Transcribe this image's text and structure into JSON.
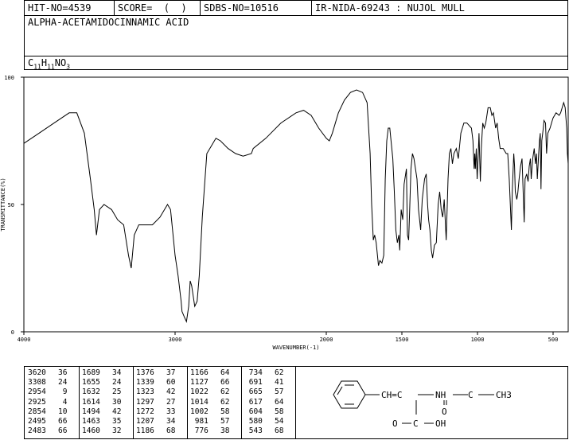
{
  "header": {
    "hit_no": "HIT-NO=4539",
    "score": "SCORE=  (  )",
    "sdbs_no": "SDBS-NO=10516",
    "ir_id": "IR-NIDA-69243 : NUJOL MULL",
    "compound_name": "ALPHA-ACETAMIDOCINNAMIC ACID",
    "formula": {
      "c": "C",
      "c_n": "11",
      "h": "H",
      "h_n": "11",
      "rest": "NO",
      "o_n": "3"
    }
  },
  "chart_data": {
    "type": "line",
    "xlabel": "WAVENUMBER(-1)",
    "ylabel": "TRANSMITTANCE(%)",
    "xlim": [
      4000,
      400
    ],
    "ylim": [
      0,
      100
    ],
    "x_ticks": [
      4000,
      3000,
      2000,
      1500,
      1000,
      500
    ],
    "y_ticks": [
      0,
      50,
      100
    ],
    "x_tick_labels": [
      "4000",
      "3000",
      "2000",
      "1500",
      "1000",
      "500"
    ],
    "y_tick_labels": [
      "0",
      "50",
      "100"
    ],
    "series": [
      {
        "points": [
          [
            4000,
            74
          ],
          [
            3900,
            78
          ],
          [
            3800,
            82
          ],
          [
            3700,
            86
          ],
          [
            3650,
            86
          ],
          [
            3600,
            78
          ],
          [
            3560,
            60
          ],
          [
            3535,
            48
          ],
          [
            3520,
            38
          ],
          [
            3500,
            48
          ],
          [
            3470,
            50
          ],
          [
            3420,
            48
          ],
          [
            3380,
            44
          ],
          [
            3340,
            42
          ],
          [
            3308,
            30
          ],
          [
            3290,
            25
          ],
          [
            3270,
            38
          ],
          [
            3240,
            42
          ],
          [
            3200,
            42
          ],
          [
            3150,
            42
          ],
          [
            3100,
            45
          ],
          [
            3050,
            50
          ],
          [
            3030,
            48
          ],
          [
            3000,
            30
          ],
          [
            2980,
            22
          ],
          [
            2960,
            12
          ],
          [
            2954,
            8
          ],
          [
            2940,
            6
          ],
          [
            2925,
            4
          ],
          [
            2910,
            10
          ],
          [
            2900,
            20
          ],
          [
            2890,
            18
          ],
          [
            2880,
            14
          ],
          [
            2870,
            10
          ],
          [
            2854,
            12
          ],
          [
            2840,
            22
          ],
          [
            2820,
            45
          ],
          [
            2790,
            70
          ],
          [
            2770,
            72
          ],
          [
            2730,
            76
          ],
          [
            2700,
            75
          ],
          [
            2650,
            72
          ],
          [
            2600,
            70
          ],
          [
            2550,
            69
          ],
          [
            2495,
            70
          ],
          [
            2483,
            72
          ],
          [
            2400,
            76
          ],
          [
            2300,
            82
          ],
          [
            2200,
            86
          ],
          [
            2150,
            87
          ],
          [
            2100,
            85
          ],
          [
            2050,
            80
          ],
          [
            2000,
            76
          ],
          [
            1980,
            75
          ],
          [
            1960,
            78
          ],
          [
            1920,
            86
          ],
          [
            1880,
            91
          ],
          [
            1840,
            94
          ],
          [
            1800,
            95
          ],
          [
            1760,
            94
          ],
          [
            1730,
            90
          ],
          [
            1710,
            70
          ],
          [
            1700,
            50
          ],
          [
            1689,
            36
          ],
          [
            1680,
            38
          ],
          [
            1670,
            35
          ],
          [
            1655,
            26
          ],
          [
            1645,
            28
          ],
          [
            1632,
            27
          ],
          [
            1620,
            30
          ],
          [
            1610,
            60
          ],
          [
            1600,
            75
          ],
          [
            1590,
            80
          ],
          [
            1580,
            80
          ],
          [
            1570,
            74
          ],
          [
            1560,
            68
          ],
          [
            1550,
            55
          ],
          [
            1540,
            40
          ],
          [
            1530,
            35
          ],
          [
            1520,
            38
          ],
          [
            1514,
            32
          ],
          [
            1505,
            48
          ],
          [
            1494,
            44
          ],
          [
            1485,
            58
          ],
          [
            1470,
            64
          ],
          [
            1463,
            38
          ],
          [
            1455,
            36
          ],
          [
            1450,
            45
          ],
          [
            1440,
            64
          ],
          [
            1430,
            70
          ],
          [
            1420,
            68
          ],
          [
            1400,
            60
          ],
          [
            1390,
            48
          ],
          [
            1376,
            40
          ],
          [
            1365,
            52
          ],
          [
            1350,
            60
          ],
          [
            1339,
            62
          ],
          [
            1330,
            50
          ],
          [
            1323,
            44
          ],
          [
            1315,
            40
          ],
          [
            1305,
            32
          ],
          [
            1297,
            29
          ],
          [
            1285,
            34
          ],
          [
            1272,
            35
          ],
          [
            1260,
            50
          ],
          [
            1250,
            55
          ],
          [
            1240,
            48
          ],
          [
            1230,
            45
          ],
          [
            1220,
            52
          ],
          [
            1207,
            36
          ],
          [
            1195,
            60
          ],
          [
            1186,
            70
          ],
          [
            1176,
            72
          ],
          [
            1166,
            66
          ],
          [
            1156,
            70
          ],
          [
            1140,
            72
          ],
          [
            1127,
            68
          ],
          [
            1110,
            78
          ],
          [
            1090,
            82
          ],
          [
            1070,
            82
          ],
          [
            1040,
            80
          ],
          [
            1030,
            75
          ],
          [
            1022,
            64
          ],
          [
            1018,
            70
          ],
          [
            1014,
            64
          ],
          [
            1008,
            72
          ],
          [
            1002,
            60
          ],
          [
            995,
            70
          ],
          [
            990,
            78
          ],
          [
            981,
            59
          ],
          [
            975,
            72
          ],
          [
            965,
            82
          ],
          [
            955,
            80
          ],
          [
            945,
            82
          ],
          [
            930,
            88
          ],
          [
            915,
            88
          ],
          [
            905,
            85
          ],
          [
            895,
            86
          ],
          [
            880,
            80
          ],
          [
            870,
            82
          ],
          [
            860,
            76
          ],
          [
            850,
            72
          ],
          [
            830,
            72
          ],
          [
            810,
            70
          ],
          [
            800,
            70
          ],
          [
            790,
            60
          ],
          [
            776,
            40
          ],
          [
            770,
            55
          ],
          [
            760,
            70
          ],
          [
            755,
            65
          ],
          [
            750,
            55
          ],
          [
            740,
            52
          ],
          [
            734,
            54
          ],
          [
            725,
            60
          ],
          [
            715,
            65
          ],
          [
            705,
            68
          ],
          [
            691,
            43
          ],
          [
            685,
            60
          ],
          [
            675,
            62
          ],
          [
            665,
            59
          ],
          [
            658,
            65
          ],
          [
            650,
            68
          ],
          [
            645,
            60
          ],
          [
            635,
            68
          ],
          [
            625,
            72
          ],
          [
            617,
            66
          ],
          [
            610,
            70
          ],
          [
            604,
            60
          ],
          [
            595,
            70
          ],
          [
            590,
            75
          ],
          [
            585,
            78
          ],
          [
            580,
            56
          ],
          [
            575,
            75
          ],
          [
            565,
            80
          ],
          [
            560,
            83
          ],
          [
            550,
            82
          ],
          [
            543,
            70
          ],
          [
            535,
            78
          ],
          [
            520,
            80
          ],
          [
            505,
            83
          ],
          [
            500,
            84
          ],
          [
            480,
            86
          ],
          [
            460,
            85
          ],
          [
            450,
            86
          ],
          [
            430,
            90
          ],
          [
            420,
            88
          ],
          [
            410,
            80
          ],
          [
            405,
            70
          ],
          [
            400,
            66
          ]
        ]
      }
    ]
  },
  "peak_columns": [
    [
      [
        "3620",
        "36"
      ],
      [
        "3308",
        "24"
      ],
      [
        "2954",
        "9"
      ],
      [
        "2925",
        "4"
      ],
      [
        "2854",
        "10"
      ],
      [
        "2495",
        "66"
      ],
      [
        "2483",
        "66"
      ]
    ],
    [
      [
        "1689",
        "34"
      ],
      [
        "1655",
        "24"
      ],
      [
        "1632",
        "25"
      ],
      [
        "1614",
        "30"
      ],
      [
        "1494",
        "42"
      ],
      [
        "1463",
        "35"
      ],
      [
        "1460",
        "32"
      ]
    ],
    [
      [
        "1376",
        "37"
      ],
      [
        "1339",
        "60"
      ],
      [
        "1323",
        "42"
      ],
      [
        "1297",
        "27"
      ],
      [
        "1272",
        "33"
      ],
      [
        "1207",
        "34"
      ],
      [
        "1186",
        "68"
      ]
    ],
    [
      [
        "1166",
        "64"
      ],
      [
        "1127",
        "66"
      ],
      [
        "1022",
        "62"
      ],
      [
        "1014",
        "62"
      ],
      [
        "1002",
        "58"
      ],
      [
        "981",
        "57"
      ],
      [
        "776",
        "38"
      ]
    ],
    [
      [
        "734",
        "62"
      ],
      [
        "691",
        "41"
      ],
      [
        "665",
        "57"
      ],
      [
        "617",
        "64"
      ],
      [
        "604",
        "58"
      ],
      [
        "580",
        "54"
      ],
      [
        "543",
        "68"
      ]
    ]
  ],
  "structure": {
    "vinyl": "CH=C",
    "nh": "NH",
    "acetyl_c": "C",
    "ch3": "CH3",
    "acid_c": "C",
    "oh": "OH",
    "o_left": "O",
    "o_right": "O"
  }
}
